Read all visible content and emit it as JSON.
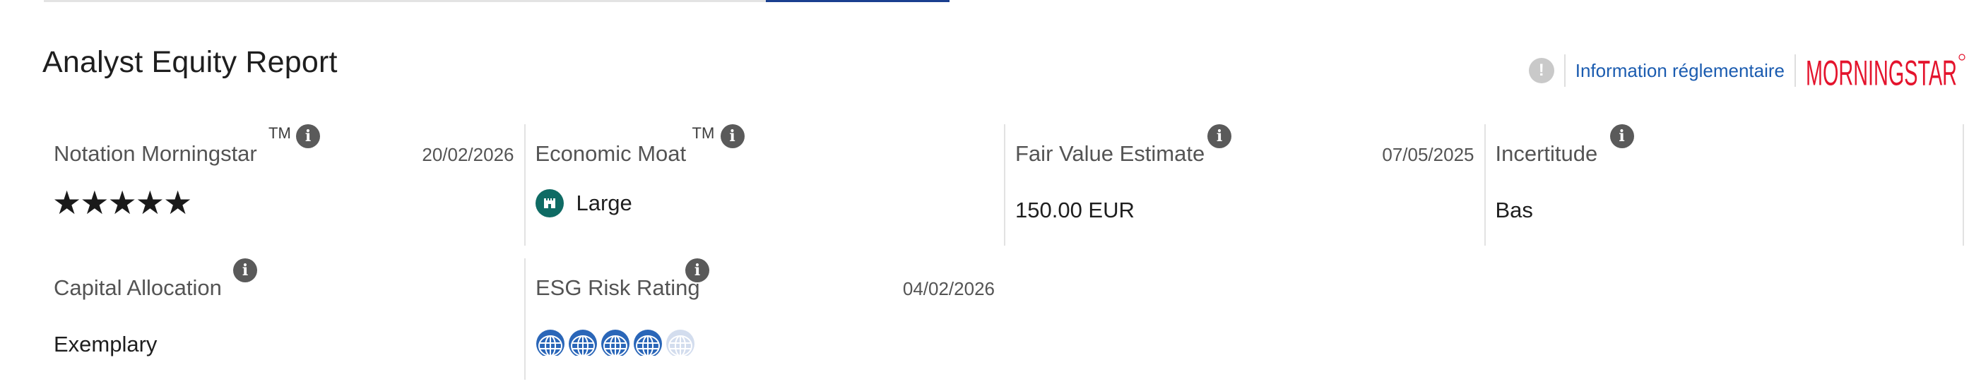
{
  "page_title": "Analyst Equity Report",
  "header": {
    "alert_icon": "exclamation-icon",
    "reg_link": "Information réglementaire",
    "logo_text": "MORNINGSTAR",
    "logo_color": "#e4142d"
  },
  "cards": {
    "rating": {
      "label": "Notation Morningstar",
      "tm": "TM",
      "date": "20/02/2026",
      "stars": 5
    },
    "moat": {
      "label": "Economic Moat",
      "tm": "TM",
      "value": "Large"
    },
    "fair_value": {
      "label": "Fair Value Estimate",
      "date": "07/05/2025",
      "value": "150.00 EUR"
    },
    "uncertainty": {
      "label": "Incertitude",
      "value": "Bas"
    },
    "capital": {
      "label": "Capital Allocation",
      "value": "Exemplary"
    },
    "esg": {
      "label": "ESG Risk Rating",
      "date": "04/02/2026",
      "globes_filled": 4,
      "globes_total": 5
    }
  },
  "colors": {
    "accent_blue": "#1a3f8f",
    "link_blue": "#1b5cb0",
    "moat_green": "#0f6b64",
    "globe_blue": "#2a66b8"
  }
}
